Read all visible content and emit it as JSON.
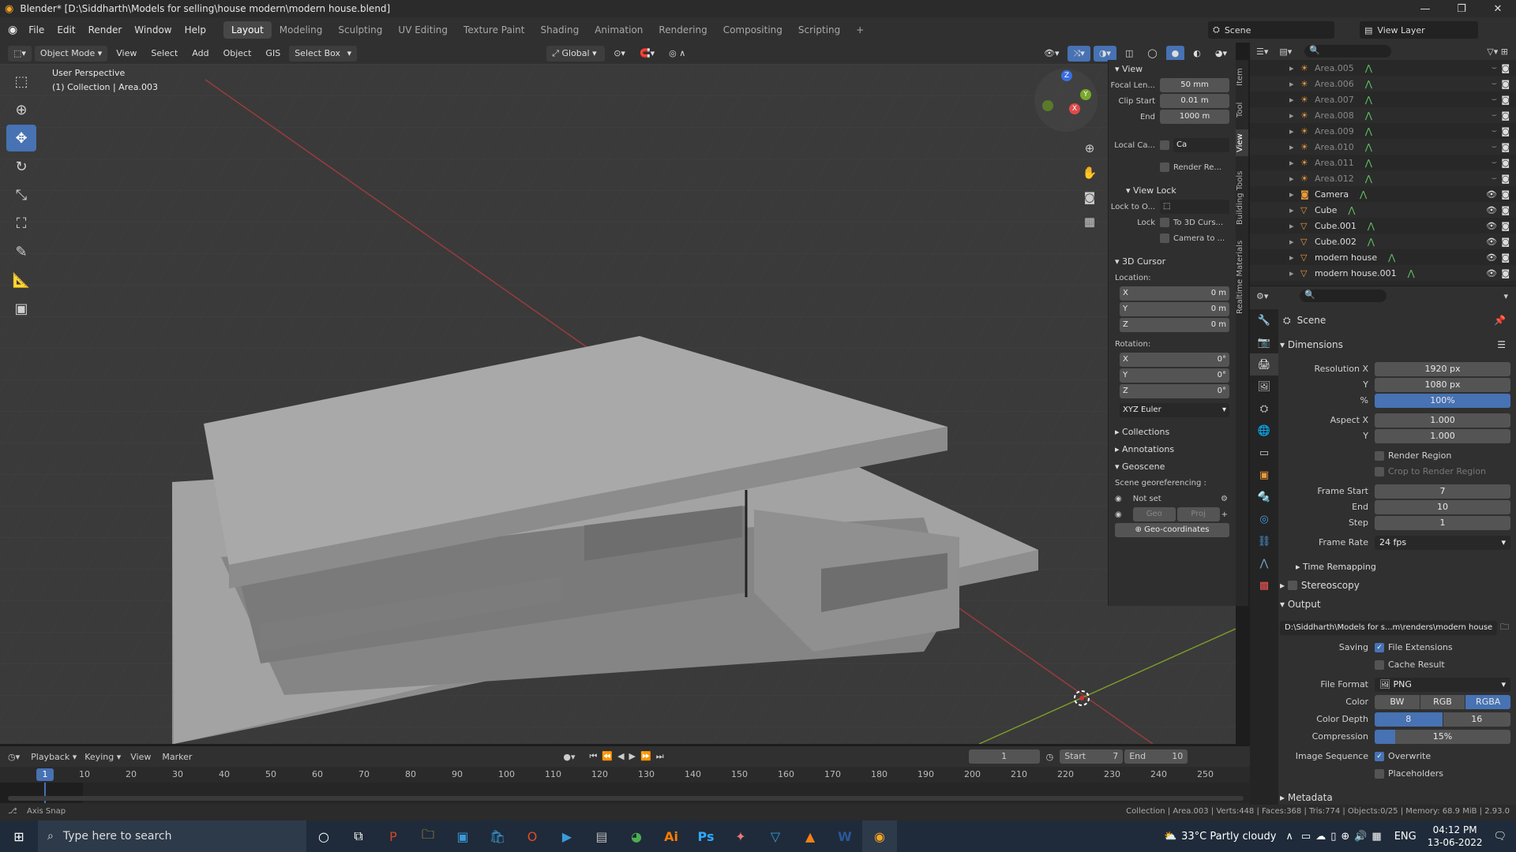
{
  "window": {
    "title": "Blender* [D:\\Siddharth\\Models for selling\\house modern\\modern house.blend]"
  },
  "menus": [
    "File",
    "Edit",
    "Render",
    "Window",
    "Help"
  ],
  "workspaces": [
    "Layout",
    "Modeling",
    "Sculpting",
    "UV Editing",
    "Texture Paint",
    "Shading",
    "Animation",
    "Rendering",
    "Compositing",
    "Scripting"
  ],
  "active_workspace": "Layout",
  "scene_field": "Scene",
  "view_layer_field": "View Layer",
  "header": {
    "mode": "Object Mode",
    "view": "View",
    "select": "Select",
    "add": "Add",
    "object": "Object",
    "gis": "GIS",
    "select_box": "Select Box",
    "transform": "Global"
  },
  "viewport": {
    "perspective": "User Perspective",
    "collection": "(1) Collection | Area.003"
  },
  "npanel": {
    "tabs": [
      "Item",
      "Tool",
      "View",
      "Building Tools",
      "Realtime Materials"
    ],
    "view_title": "View",
    "focal_label": "Focal Len...",
    "focal_value": "50 mm",
    "clip_start_label": "Clip Start",
    "clip_start_value": "0.01 m",
    "end_label": "End",
    "end_value": "1000 m",
    "local_label": "Local Ca...",
    "local_value": "Ca",
    "render_label": "Render Re...",
    "view_lock_title": "View Lock",
    "lock_to_label": "Lock to O...",
    "lock_label": "Lock",
    "lock_cursor": "To 3D Curs...",
    "lock_camera": "Camera to ...",
    "cursor_title": "3D Cursor",
    "location_label": "Location:",
    "rotation_label": "Rotation:",
    "loc": [
      {
        "axis": "X",
        "val": "0 m"
      },
      {
        "axis": "Y",
        "val": "0 m"
      },
      {
        "axis": "Z",
        "val": "0 m"
      }
    ],
    "rot": [
      {
        "axis": "X",
        "val": "0°"
      },
      {
        "axis": "Y",
        "val": "0°"
      },
      {
        "axis": "Z",
        "val": "0°"
      }
    ],
    "euler": "XYZ Euler",
    "collections": "Collections",
    "annotations": "Annotations",
    "geoscene": "Geoscene",
    "georef": "Scene georeferencing :",
    "notset": "Not set",
    "geo": "Geo",
    "proj": "Proj",
    "geocoords": "Geo-coordinates"
  },
  "outliner": {
    "rows": [
      {
        "name": "Area.005"
      },
      {
        "name": "Area.006"
      },
      {
        "name": "Area.007"
      },
      {
        "name": "Area.008"
      },
      {
        "name": "Area.009"
      },
      {
        "name": "Area.010"
      },
      {
        "name": "Area.011"
      },
      {
        "name": "Area.012"
      },
      {
        "name": "Camera"
      },
      {
        "name": "Cube"
      },
      {
        "name": "Cube.001"
      },
      {
        "name": "Cube.002"
      },
      {
        "name": "modern house"
      },
      {
        "name": "modern house.001"
      }
    ]
  },
  "props": {
    "scene": "Scene",
    "dimensions": "Dimensions",
    "res_x_label": "Resolution X",
    "res_x": "1920 px",
    "y_label": "Y",
    "res_y": "1080 px",
    "pct_label": "%",
    "pct": "100%",
    "aspect_x_label": "Aspect X",
    "aspect_x": "1.000",
    "aspect_y": "1.000",
    "render_region": "Render Region",
    "crop": "Crop to Render Region",
    "frame_start_label": "Frame Start",
    "frame_start": "7",
    "end_label": "End",
    "frame_end": "10",
    "step_label": "Step",
    "step": "1",
    "frame_rate_label": "Frame Rate",
    "frame_rate": "24 fps",
    "time_remap": "Time Remapping",
    "stereoscopy": "Stereoscopy",
    "output": "Output",
    "output_path": "D:\\Siddharth\\Models for s...m\\renders\\modern house",
    "saving_label": "Saving",
    "file_ext": "File Extensions",
    "cache": "Cache Result",
    "file_format_label": "File Format",
    "file_format": "PNG",
    "color_label": "Color",
    "color_opts": [
      "BW",
      "RGB",
      "RGBA"
    ],
    "depth_label": "Color Depth",
    "depth_opts": [
      "8",
      "16"
    ],
    "compression_label": "Compression",
    "compression": "15%",
    "image_seq_label": "Image Sequence",
    "overwrite": "Overwrite",
    "placeholders": "Placeholders",
    "metadata": "Metadata"
  },
  "timeline": {
    "menu": [
      "Playback",
      "Keying",
      "View",
      "Marker"
    ],
    "current": "1",
    "start_label": "Start",
    "start": "7",
    "end_label": "End",
    "end": "10",
    "ticks": [
      "10",
      "20",
      "30",
      "40",
      "50",
      "60",
      "70",
      "80",
      "90",
      "100",
      "110",
      "120",
      "130",
      "140",
      "150",
      "160",
      "170",
      "180",
      "190",
      "200",
      "210",
      "220",
      "230",
      "240",
      "250"
    ]
  },
  "status": {
    "left": "Axis Snap",
    "right": "Collection | Area.003 | Verts:448 | Faces:368 | Tris:774 | Objects:0/25 | Memory: 68.9 MiB | 2.93.0"
  },
  "taskbar": {
    "search": "Type here to search",
    "weather": "33°C  Partly cloudy",
    "lang": "ENG",
    "time": "04:12 PM",
    "date": "13-06-2022"
  }
}
